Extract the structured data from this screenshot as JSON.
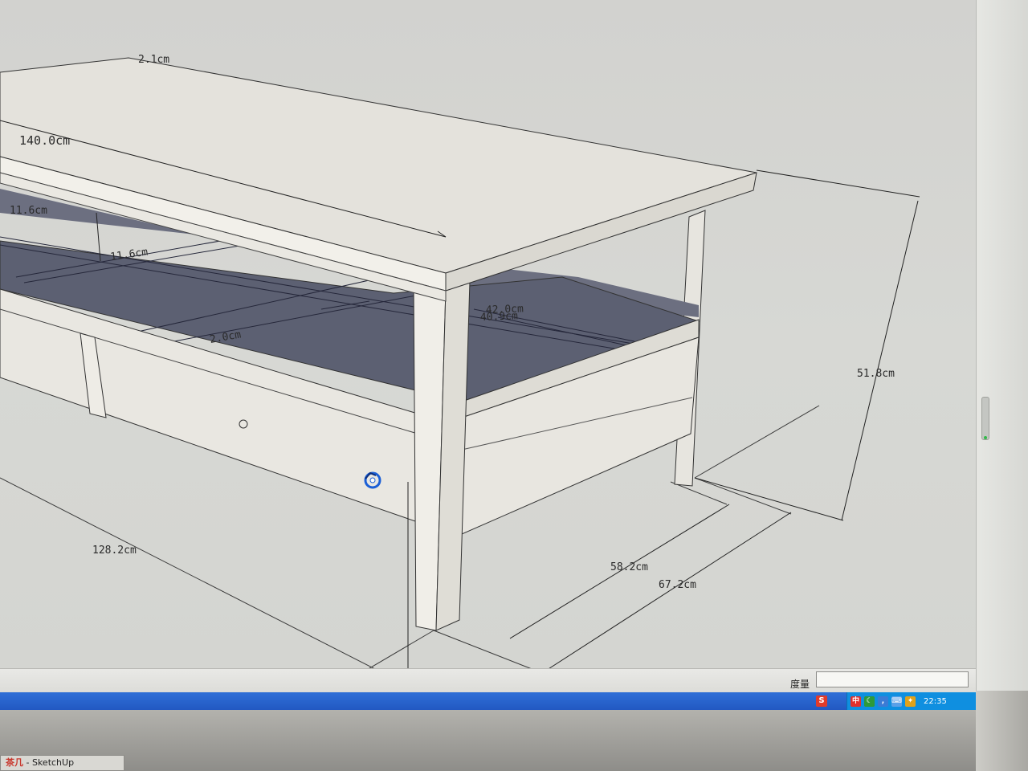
{
  "app": {
    "window_title": "茶几 - SketchUp",
    "window_title_prefix": "茶几",
    "window_title_app": " - SketchUp"
  },
  "dimensions": {
    "top_length": "140.0cm",
    "top_corner_partial": "2.1cm",
    "inner_offset": "11.6cm",
    "inner_offset_2": "11.6cm",
    "shelf_thickness": "2.0cm",
    "shelf_depth_a": "42.0cm",
    "shelf_depth_b": "40.9cm",
    "height": "51.8cm",
    "base_length": "128.2cm",
    "base_depth_inner": "58.2cm",
    "base_depth_outer": "67.2cm"
  },
  "status_bar": {
    "measure_label": "度量",
    "measure_value": ""
  },
  "tray": {
    "ime": "中",
    "clock": "22:35",
    "sogou": "S"
  }
}
